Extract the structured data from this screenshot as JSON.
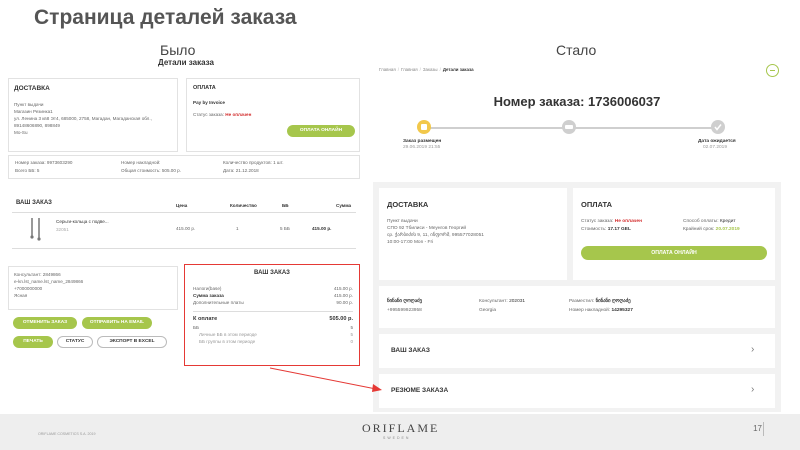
{
  "slide": {
    "title": "Страница деталей заказа",
    "before_label": "Было",
    "after_label": "Стало",
    "page_number": "17",
    "footer_note": "ORIFLAME COSMETICS S.A. 2019",
    "logo": "ORIFLAME",
    "logo_sub": "SWEDEN"
  },
  "old_page": {
    "heading": "Детали заказа",
    "delivery": {
      "title": "ДОСТАВКА",
      "lines": [
        "Пункт выдачи",
        "Магазин Резинка1",
        "ул. Ленина 3 кв8 Эт4, 685000, 2758, Магадан, Магаданская обл.,",
        "89148606890, 898849",
        "Mo-Su"
      ]
    },
    "payment": {
      "title": "ОПЛАТА",
      "method": "Pay by Invoice",
      "status_label": "Статус заказа:",
      "status_value": "Не оплачен",
      "button": "ОПЛАТА ОНЛАЙН"
    },
    "info": {
      "order_number": "Номер заказа: 9973603290",
      "total_bb": "Всего ББ: 5",
      "invoice_number": "Номер накладной:",
      "total_cost": "Общая стоимость: 505.00 р.",
      "products_count": "Количество продуктов: 1 шт.",
      "date": "Дата: 21.12.2018"
    },
    "order": {
      "title": "ВАШ ЗАКАЗ",
      "columns": [
        "Цена",
        "Количество",
        "ББ",
        "Сумма"
      ],
      "item_name": "Серьги-кольца с подве...",
      "item_code": "32051",
      "item_price": "415.00 р.",
      "item_qty": "1",
      "item_bb": "5 ББ",
      "item_sum": "415.00 р."
    },
    "consultant": {
      "lines": [
        "Консультант: 2849866",
        "e-kn.lst_name.lst_name_2849866",
        "+7000000000",
        "Ясная"
      ]
    },
    "buttons": {
      "cancel": "ОТМЕНИТЬ ЗАКАЗ",
      "send_bank": "ОТПРАВИТЬ НА EMAIL",
      "print": "ПЕЧАТЬ",
      "status": "СТАТУС",
      "export": "ЭКСПОРТ В EXCEL"
    },
    "summary": {
      "title": "ВАШ ЗАКАЗ",
      "rows": [
        {
          "label": "Налоги(base)",
          "value": "415.00 р."
        },
        {
          "label": "Сумма заказа",
          "value": "415.00 р."
        },
        {
          "label": "Дополнительные платы",
          "value": "90.00 р."
        }
      ],
      "pay_label": "К оплате",
      "pay_value": "505.00 р.",
      "bb_label": "ББ",
      "bb_value": "5",
      "bb_line1": "Личные ББ в этом периоде",
      "bb_line1_value": "5",
      "bb_line2": "ББ группы в этом периоде",
      "bb_line2_value": "0"
    }
  },
  "new_page": {
    "breadcrumb": [
      "Главная",
      "Главная",
      "Заказы",
      "Детали заказа"
    ],
    "order_title": "Номер заказа: 1736006037",
    "steps": [
      {
        "label": "Заказ размещен",
        "date": "29.06.2019 21:55"
      },
      {
        "label": "",
        "date": ""
      },
      {
        "label": "Дата ожидается",
        "date": "02.07.2019"
      }
    ],
    "delivery": {
      "title": "ДОСТАВКА",
      "lines": [
        "Пункт выдачи",
        "СПО 92 Тбилиси - Меунгов Георгий",
        "ср. ქარბიძის 9, 11, ინფორმ, 995577028051",
        "10:00-17:00 Mon - Fri"
      ]
    },
    "payment": {
      "title": "ОПЛАТА",
      "status_label": "Статус заказа:",
      "status_value": "Не оплачен",
      "cost_label": "Стоимость:",
      "cost_value": "17.17 GEL",
      "method_label": "Способ оплаты:",
      "method_value": "Кредит",
      "deadline_label": "Крайний срок:",
      "deadline_value": "20.07.2019",
      "button": "ОПЛАТА ОНЛАЙН"
    },
    "contacts": {
      "name1": "ნინანი ღოღაძე",
      "phone1": "+995599923958",
      "consultant_label": "Консультант:",
      "consultant_value": "202031",
      "country": "Georgia",
      "placed_label": "Разместил:",
      "placed_value": "ნინანი ღოღაძე",
      "invoice_label": "Номер накладной:",
      "invoice_value": "14295327"
    },
    "your_order": "ВАШ ЗАКАЗ",
    "summary": "РЕЗЮМЕ ЗАКАЗА"
  },
  "colors": {
    "green": "#a6c64c",
    "red_status": "#d32f2f",
    "highlight_red": "#e53935"
  }
}
